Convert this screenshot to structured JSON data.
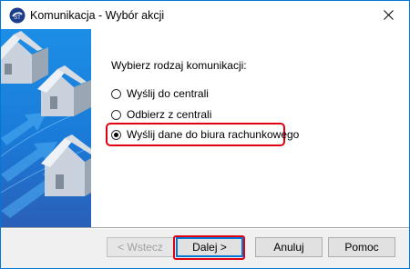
{
  "window": {
    "title": "Komunikacja - Wybór akcji",
    "accent_color": "#0078d7"
  },
  "content": {
    "prompt": "Wybierz rodzaj komunikacji:",
    "options": [
      {
        "label": "Wyślij do centrali",
        "checked": false
      },
      {
        "label": "Odbierz z centrali",
        "checked": false
      },
      {
        "label": "Wyślij dane do biura rachunkowego",
        "checked": true
      }
    ],
    "highlight_color": "#e1000f"
  },
  "buttons": {
    "back": "< Wstecz",
    "next": "Dalej >",
    "cancel": "Anuluj",
    "help": "Pomoc"
  },
  "icons": {
    "app": "app-logo-icon",
    "close": "close-icon"
  }
}
